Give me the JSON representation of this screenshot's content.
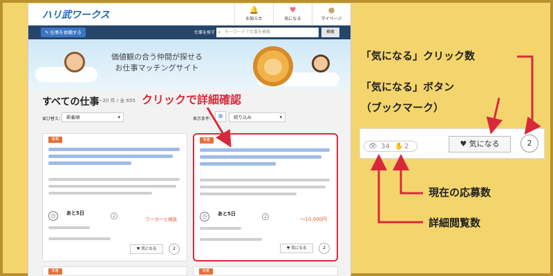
{
  "header": {
    "logo": "ハリ武ワークス",
    "nav": [
      {
        "label": "お知らせ",
        "icon": "bell-icon",
        "glyph": "🔔"
      },
      {
        "label": "気になる",
        "icon": "heart-icon",
        "glyph": "♥"
      },
      {
        "label": "マイページ",
        "icon": "avatar-icon",
        "glyph": "●"
      }
    ]
  },
  "toolbar": {
    "request_button": "✎ 仕事を依頼する",
    "search_label": "仕事を探す",
    "search_placeholder": "キーワードで仕事を検索",
    "search_button": "検索"
  },
  "hero": {
    "line1": "価値観の合う仲間が探せる",
    "line2": "お仕事マッチングサイト"
  },
  "list": {
    "title": "すべての仕事",
    "count": "1～20 件 / 全 655",
    "sort_label": "並び替え：",
    "sort_value": "新着順",
    "show_label": "表示条件：",
    "filter_value": "絞り込み"
  },
  "cards": [
    {
      "tag": "新着",
      "deadline": "あと5日",
      "reward": "ワーカーと相談",
      "views": "34",
      "applies": "2",
      "like_label": "気になる",
      "like_count": "2"
    },
    {
      "tag": "新着",
      "deadline": "あと5日",
      "reward": "～10,000円",
      "views": "34",
      "applies": "2",
      "like_label": "気になる",
      "like_count": "2"
    }
  ],
  "zoom": {
    "views": "34",
    "applies": "2",
    "like_label": "気になる",
    "like_count": "2"
  },
  "annotations": {
    "click_detail": "クリックで詳細確認",
    "like_click_count": "「気になる」クリック数",
    "like_button": "「気になる」ボタン",
    "bookmark": "（ブックマーク）",
    "current_applies": "現在の応募数",
    "detail_views": "詳細閲覧数"
  },
  "colors": {
    "accent_red": "#d8293a",
    "background_yellow": "#f4d56d",
    "nav_blue": "#25456a"
  }
}
